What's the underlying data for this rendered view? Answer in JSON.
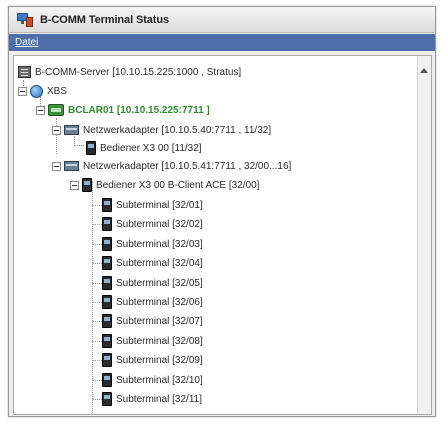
{
  "window": {
    "title": "B-COMM Terminal Status"
  },
  "menu": {
    "items": [
      "Datei"
    ]
  },
  "tree": {
    "server_label": "B-COMM-Server [10.10.15.225:1000 , Stratus]",
    "root_label": "XBS",
    "host_label": "BCLAR01 [10.10.15.225:7711 ]",
    "adapter1_label": "Netzwerkadapter [10.10.5.40:7711 , 11/32]",
    "adapter1_child": "Bediener X3 00 [11/32]",
    "adapter2_label": "Netzwerkadapter [10.10.5.41:7711 , 32/00...16]",
    "adapter2_child": "Bediener X3 00 B-Client ACE [32/00]",
    "subterminals": [
      "Subterminal [32/01]",
      "Subterminal [32/02]",
      "Subterminal [32/03]",
      "Subterminal [32/04]",
      "Subterminal [32/05]",
      "Subterminal [32/06]",
      "Subterminal [32/07]",
      "Subterminal [32/08]",
      "Subterminal [32/09]",
      "Subterminal [32/10]",
      "Subterminal [32/11]"
    ]
  },
  "colors": {
    "menubar": "#4d6ea8",
    "host_text": "#2f8a2f"
  }
}
